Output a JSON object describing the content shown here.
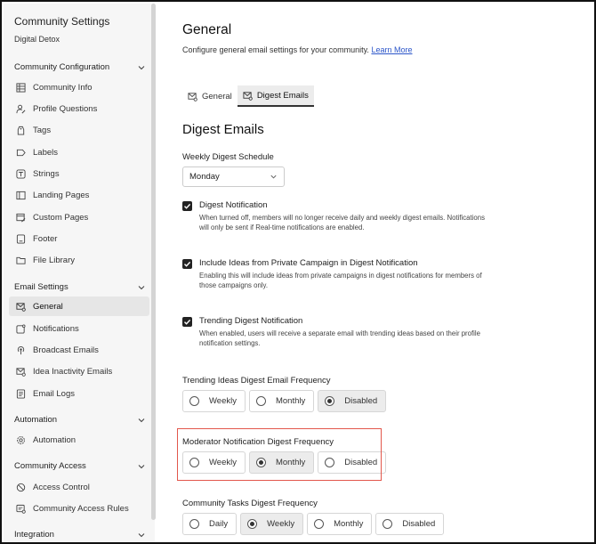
{
  "sidebar": {
    "title": "Community Settings",
    "subtitle": "Digital Detox",
    "sections": {
      "community_config": "Community Configuration",
      "email_settings": "Email Settings",
      "automation": "Automation",
      "community_access": "Community Access",
      "integration": "Integration"
    },
    "items": {
      "community_info": "Community Info",
      "profile_questions": "Profile Questions",
      "tags": "Tags",
      "labels": "Labels",
      "strings": "Strings",
      "landing_pages": "Landing Pages",
      "custom_pages": "Custom Pages",
      "footer": "Footer",
      "file_library": "File Library",
      "general": "General",
      "notifications": "Notifications",
      "broadcast_emails": "Broadcast Emails",
      "idea_inactivity_emails": "Idea Inactivity Emails",
      "email_logs": "Email Logs",
      "automation": "Automation",
      "access_control": "Access Control",
      "community_access_rules": "Community Access Rules"
    }
  },
  "main": {
    "title": "General",
    "description": "Configure general email settings for your community.",
    "learn_more": "Learn More",
    "tabs": [
      {
        "label": "General"
      },
      {
        "label": "Digest Emails"
      }
    ],
    "section_title": "Digest Emails",
    "weekly_schedule": {
      "label": "Weekly Digest Schedule",
      "value": "Monday"
    },
    "checkboxes": [
      {
        "title": "Digest Notification",
        "desc": "When turned off, members will no longer receive daily and weekly digest emails. Notifications will only be sent if Real-time notifications are enabled.",
        "checked": true
      },
      {
        "title": "Include Ideas from Private Campaign in Digest Notification",
        "desc": "Enabling this will include ideas from private campaigns in digest notifications for members of those campaigns only.",
        "checked": true
      },
      {
        "title": "Trending Digest Notification",
        "desc": "When enabled, users will receive a separate email with trending ideas based on their profile notification settings.",
        "checked": true
      }
    ],
    "trending_freq": {
      "label": "Trending Ideas Digest Email Frequency",
      "options": [
        "Weekly",
        "Monthly",
        "Disabled"
      ],
      "selected": "Disabled"
    },
    "moderator_freq": {
      "label": "Moderator Notification Digest Frequency",
      "options": [
        "Weekly",
        "Monthly",
        "Disabled"
      ],
      "selected": "Monthly"
    },
    "tasks_freq": {
      "label": "Community Tasks Digest Frequency",
      "options": [
        "Daily",
        "Weekly",
        "Monthly",
        "Disabled"
      ],
      "selected": "Weekly"
    }
  },
  "colors": {
    "link": "#2b55c9",
    "highlight_border": "#e2574c",
    "sidebar_bg": "#f6f6f6"
  }
}
